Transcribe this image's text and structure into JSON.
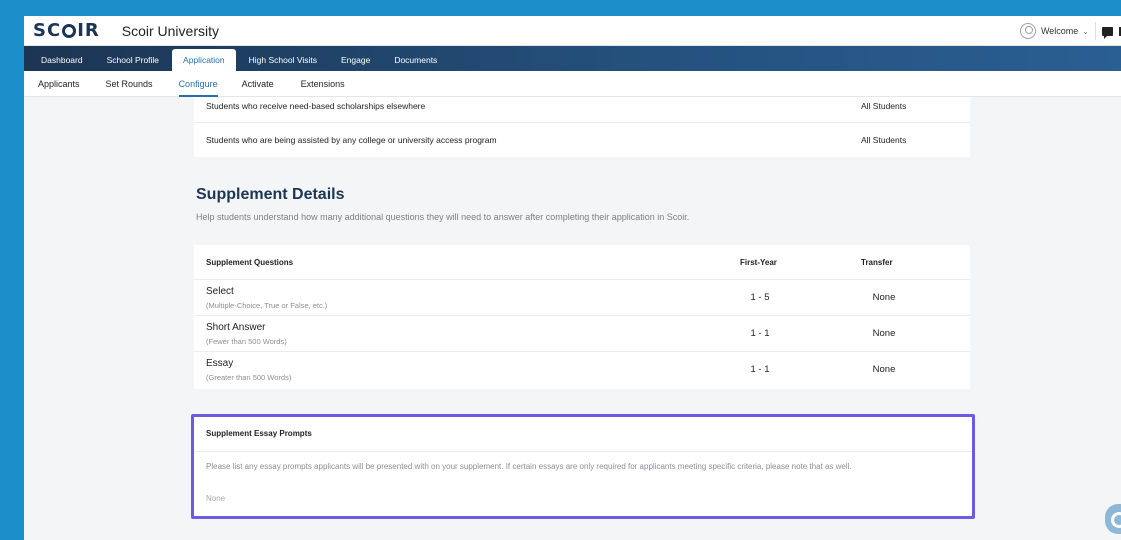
{
  "app": {
    "logo": "SCOIR",
    "university": "Scoir University",
    "welcome": "Welcome"
  },
  "main_nav": [
    {
      "label": "Dashboard"
    },
    {
      "label": "School Profile"
    },
    {
      "label": "Application",
      "active": true
    },
    {
      "label": "High School Visits"
    },
    {
      "label": "Engage"
    },
    {
      "label": "Documents"
    }
  ],
  "sub_nav": [
    {
      "label": "Applicants"
    },
    {
      "label": "Set Rounds"
    },
    {
      "label": "Configure",
      "active": true
    },
    {
      "label": "Activate"
    },
    {
      "label": "Extensions"
    }
  ],
  "eligibility_rows": [
    {
      "text": "Students who receive need-based scholarships elsewhere",
      "value": "All Students"
    },
    {
      "text": "Students who are being assisted by any college or university access program",
      "value": "All Students"
    }
  ],
  "supplement": {
    "title": "Supplement Details",
    "subtitle": "Help students understand how many additional questions they will need to answer after completing their application in Scoir.",
    "headers": {
      "questions": "Supplement Questions",
      "first_year": "First-Year",
      "transfer": "Transfer"
    },
    "rows": [
      {
        "name": "Select",
        "desc": "(Multiple-Choice, True or False, etc.)",
        "first_year": "1 - 5",
        "transfer": "None"
      },
      {
        "name": "Short Answer",
        "desc": "(Fewer than 500 Words)",
        "first_year": "1 - 1",
        "transfer": "None"
      },
      {
        "name": "Essay",
        "desc": "(Greater than 500 Words)",
        "first_year": "1 - 1",
        "transfer": "None"
      }
    ]
  },
  "essay_prompts": {
    "title": "Supplement Essay Prompts",
    "description": "Please list any essay prompts applicants will be presented with on your supplement. If certain essays are only required for applicants meeting specific criteria, please note that as well.",
    "value": "None"
  },
  "colors": {
    "navy": "#1c3553",
    "accent_blue": "#2b6cb0",
    "highlight_border": "#6a5be0",
    "outer_background": "#1a8fc9"
  }
}
